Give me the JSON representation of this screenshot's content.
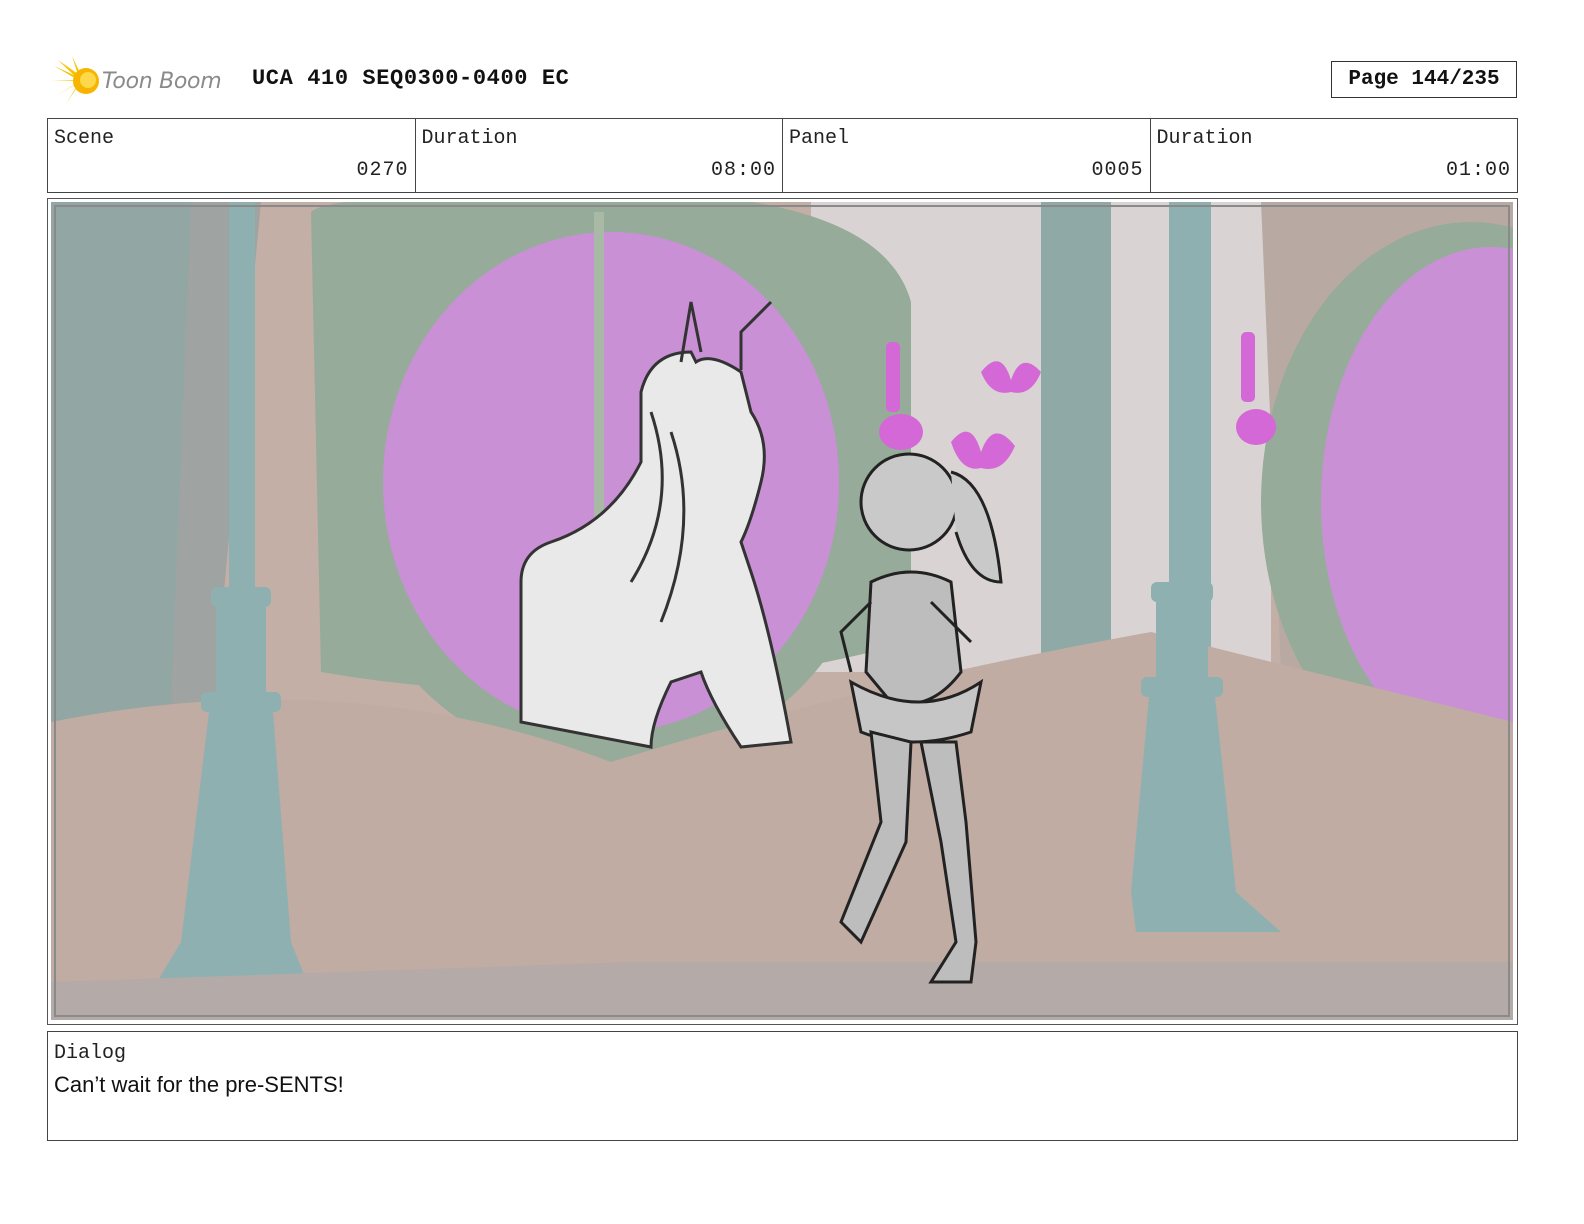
{
  "header": {
    "logo_text": "Toon Boom",
    "title": "UCA 410 SEQ0300-0400 EC",
    "page": "Page 144/235"
  },
  "info": {
    "scene_label": "Scene",
    "scene_value": "0270",
    "scene_duration_label": "Duration",
    "scene_duration_value": "08:00",
    "panel_label": "Panel",
    "panel_value": "0005",
    "panel_duration_label": "Duration",
    "panel_duration_value": "01:00"
  },
  "dialog": {
    "label": "Dialog",
    "text": "Can’t wait for the pre-SENTS!"
  },
  "colors": {
    "wall": "#c3afa5",
    "window_magenta": "#c990d6",
    "frame_green": "#97ab9a",
    "pillar_teal": "#8fb0b1",
    "floor": "#b4aaa7",
    "logo_yellow": "#f5c400"
  }
}
